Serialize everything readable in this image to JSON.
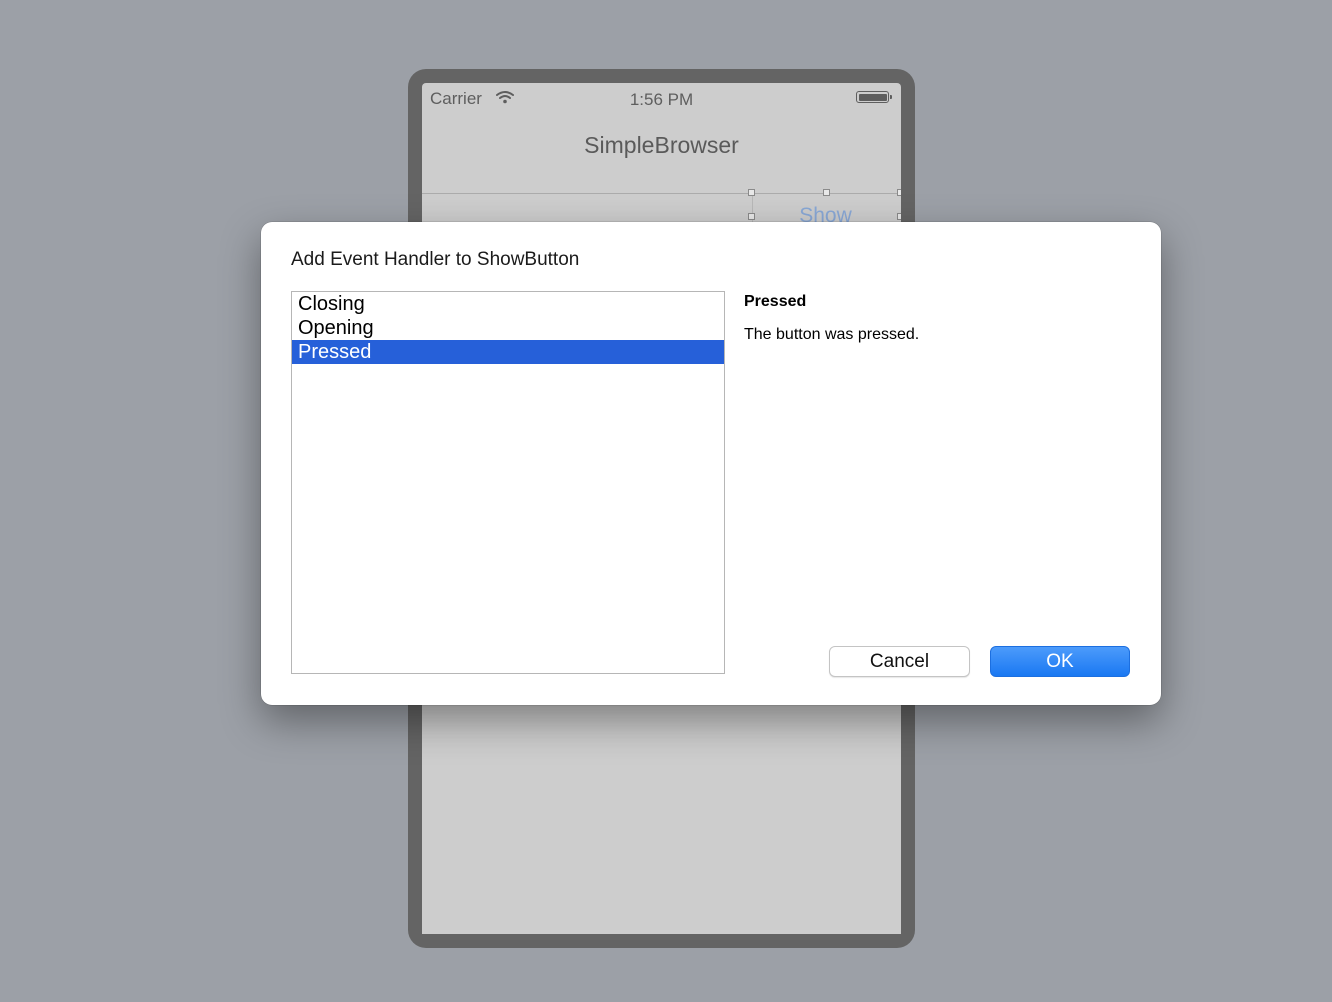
{
  "simulator": {
    "status_bar": {
      "carrier": "Carrier",
      "time": "1:56 PM"
    },
    "nav_title": "SimpleBrowser",
    "show_button_label": "Show"
  },
  "dialog": {
    "title": "Add Event Handler to ShowButton",
    "events": [
      "Closing",
      "Opening",
      "Pressed"
    ],
    "selected_event": "Pressed",
    "selected_index": 2,
    "description_title": "Pressed",
    "description_text": "The button was pressed.",
    "cancel_label": "Cancel",
    "ok_label": "OK"
  },
  "colors": {
    "selection": "#2660d9",
    "ok_button": "#1a78f2",
    "backdrop": "#9ca0a7"
  }
}
